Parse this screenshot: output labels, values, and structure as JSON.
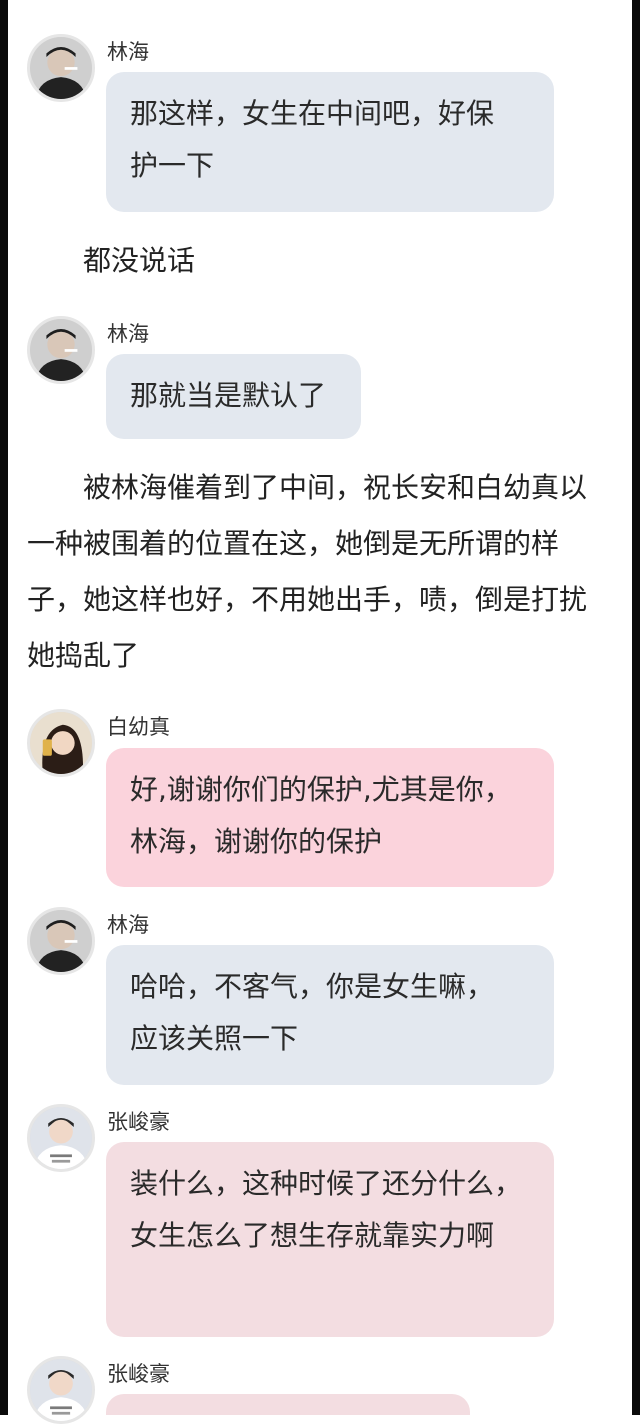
{
  "messages": [
    {
      "sender": "林海",
      "lines": [
        "那这样，女生在中间吧，好保",
        "护一下"
      ]
    },
    {
      "sender": "林海",
      "lines": [
        "那就当是默认了"
      ]
    },
    {
      "sender": "白幼真",
      "lines": [
        "好,谢谢你们的保护,尤其是你，",
        "林海，谢谢你的保护"
      ]
    },
    {
      "sender": "林海",
      "lines": [
        "哈哈，不客气，你是女生嘛，",
        "应该关照一下"
      ]
    },
    {
      "sender": "张峻豪",
      "lines": [
        "装什么，这种时候了还分什么，",
        "女生怎么了想生存就靠实力啊"
      ]
    },
    {
      "sender": "张峻豪",
      "lines": []
    }
  ],
  "narration": [
    "都没说话",
    "被林海催着到了中间，祝长安和白幼真以一种被围着的位置在这，她倒是无所谓的样子，她这样也好，不用她出手，啧，倒是打扰她捣乱了"
  ],
  "colors": {
    "bubble_gray": "#e3e8ef",
    "bubble_pink": "#fbd3dc",
    "bubble_light_pink": "#f3dde1"
  },
  "avatars": {
    "linhai": "avatar-smoking-man",
    "baiyouzhen": "avatar-girl-phone",
    "zhangjunhao": "avatar-boy-white-tshirt"
  }
}
